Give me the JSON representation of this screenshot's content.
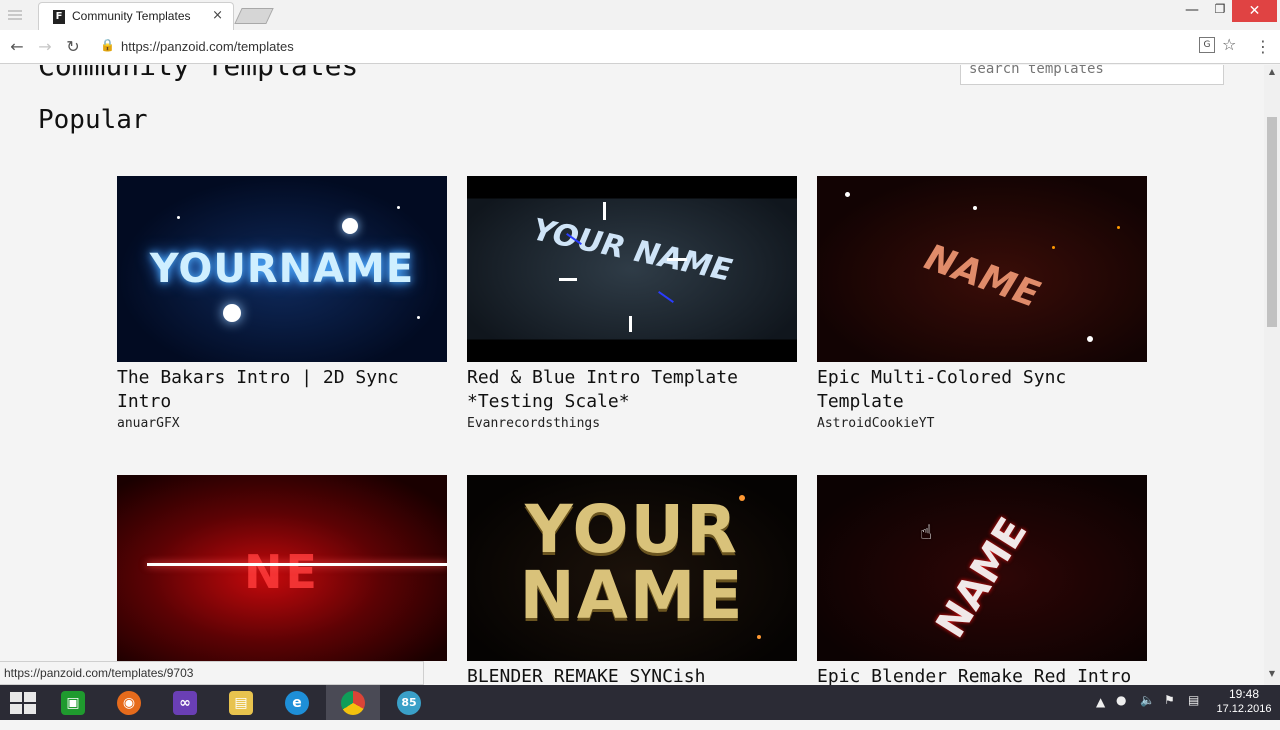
{
  "browser": {
    "tab_title": "Community Templates",
    "tab_favicon": "F",
    "tab_close": "×",
    "url": "https://panzoid.com/templates",
    "back_icon": "arrow-left",
    "forward_icon": "arrow-right",
    "reload_icon": "reload",
    "status_url": "https://panzoid.com/templates/9703",
    "minimize": "—",
    "maximize": "❐",
    "close": "✕"
  },
  "page": {
    "title": "Community Templates",
    "search_placeholder": "search templates",
    "section_title": "Popular"
  },
  "templates": [
    {
      "title": "The Bakars Intro | 2D Sync Intro",
      "author": "anuarGFX",
      "thumb_text": "YOURNAME"
    },
    {
      "title": "Red & Blue Intro Template *Testing Scale*",
      "author": "Evanrecordsthings",
      "thumb_text": "YOUR NAME"
    },
    {
      "title": "Epic Multi-Colored Sync Template",
      "author": "AstroidCookieYT",
      "thumb_text": "NAME"
    },
    {
      "title": "",
      "author": "",
      "thumb_text": "NE"
    },
    {
      "title": "BLENDER REMAKE SYNCish",
      "author": "",
      "thumb_text": "YOUR NAME"
    },
    {
      "title": "Epic Blender Remake Red Intro",
      "author": "",
      "thumb_text": "NAME"
    }
  ],
  "taskbar": {
    "apps": [
      "windows-start",
      "store",
      "firefox",
      "visual-studio",
      "file-explorer",
      "internet-explorer",
      "chrome",
      "app-85"
    ],
    "app85_label": "85",
    "time": "19:48",
    "date": "17.12.2016"
  }
}
